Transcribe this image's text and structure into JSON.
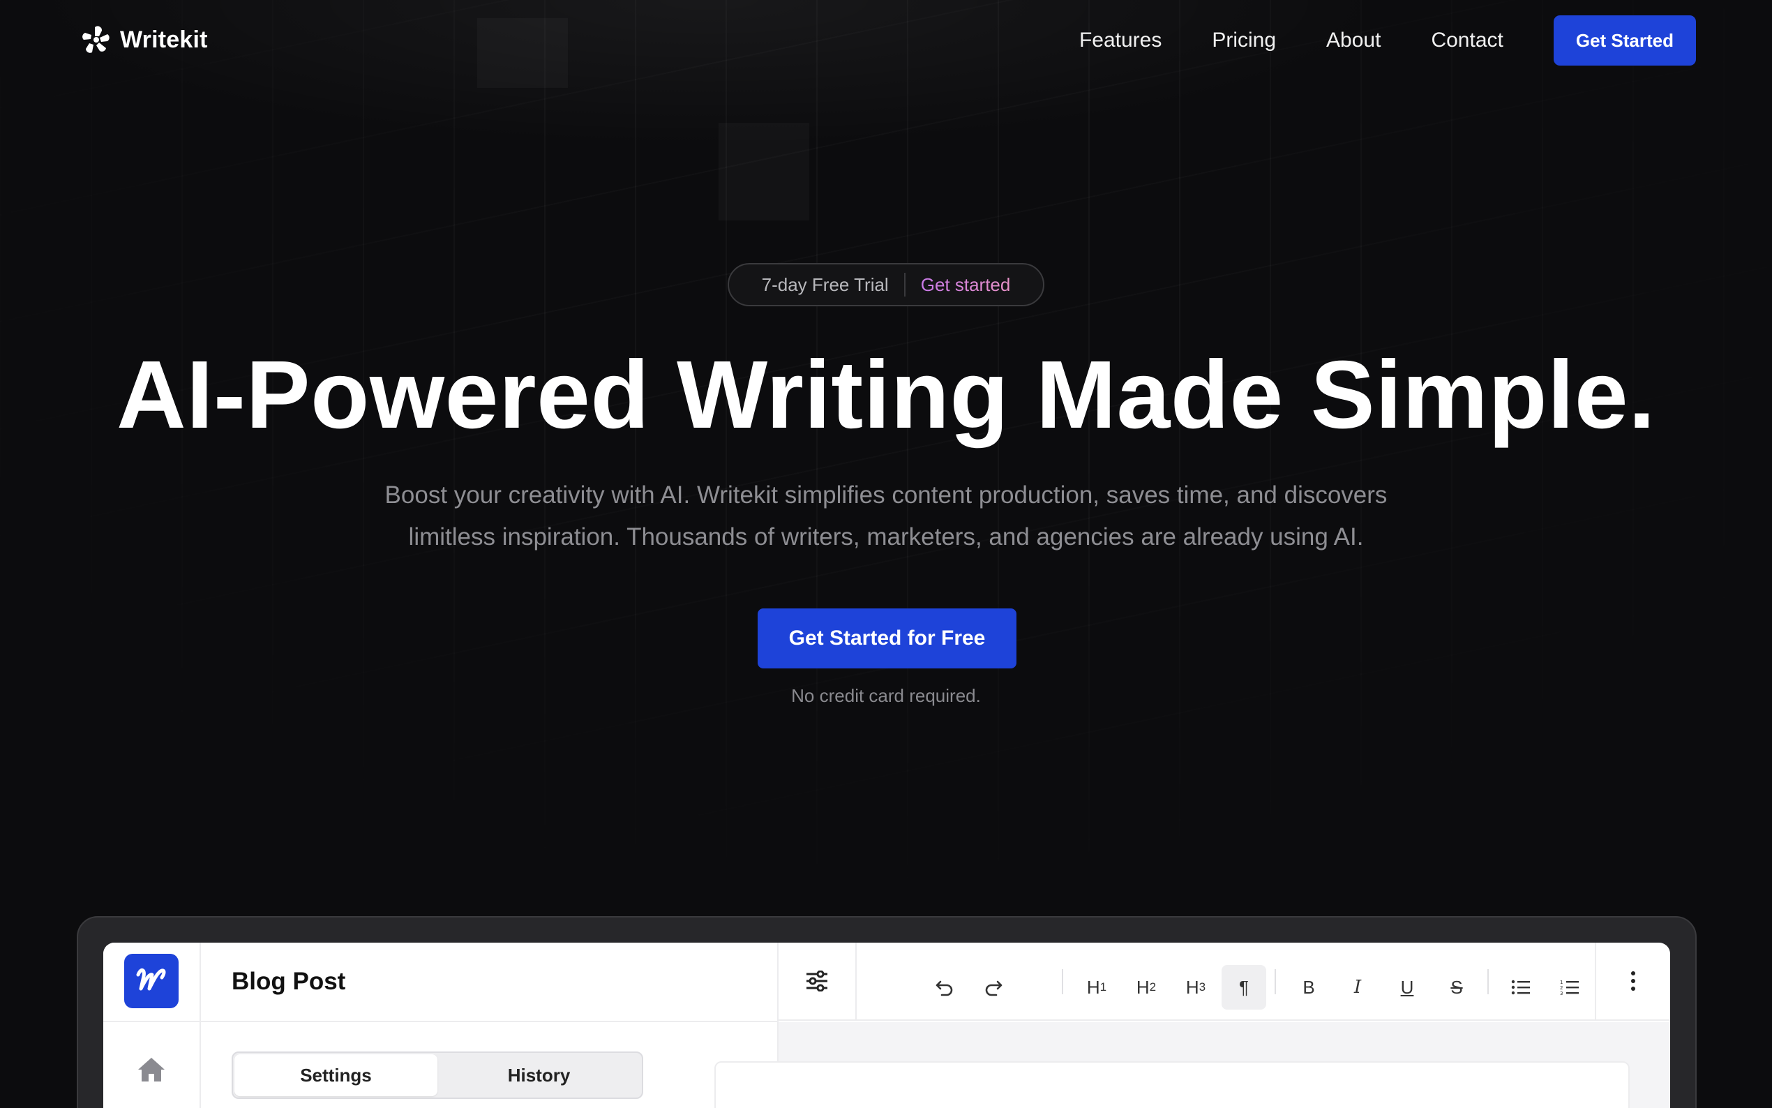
{
  "brand": {
    "name": "Writekit"
  },
  "nav": {
    "links": [
      "Features",
      "Pricing",
      "About",
      "Contact"
    ],
    "cta_label": "Get Started"
  },
  "hero": {
    "badge_left": "7-day Free Trial",
    "badge_right": "Get started",
    "title": "AI-Powered Writing Made Simple.",
    "subtitle_line1": "Boost your creativity with AI. Writekit simplifies content production, saves time, and discovers",
    "subtitle_line2": "limitless inspiration. Thousands of writers, marketers, and agencies are already using AI.",
    "cta_label": "Get Started for Free",
    "cta_note": "No credit card required."
  },
  "app_preview": {
    "doc_title": "Blog Post",
    "tabs": [
      "Settings",
      "History"
    ],
    "active_tab": "Settings",
    "toolbar_icons": [
      "undo-icon",
      "redo-icon",
      "heading-1-icon",
      "heading-2-icon",
      "heading-3-icon",
      "paragraph-icon",
      "bold-icon",
      "italic-icon",
      "underline-icon",
      "strikethrough-icon",
      "bullet-list-icon",
      "numbered-list-icon"
    ],
    "active_tool": "paragraph-icon"
  },
  "colors": {
    "background": "#0c0c0e",
    "accent": "#1e43d9",
    "badge_gradient_start": "#c97ae8",
    "badge_gradient_end": "#e892c8"
  }
}
